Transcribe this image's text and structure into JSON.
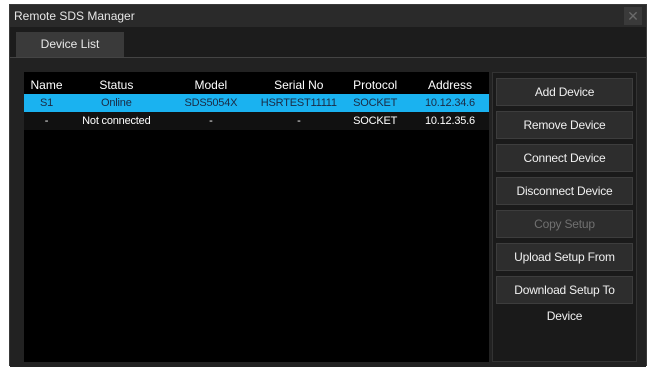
{
  "window": {
    "title": "Remote SDS Manager",
    "close_glyph": "✕"
  },
  "tabs": [
    {
      "label": "Device List"
    }
  ],
  "table": {
    "columns": [
      "Name",
      "Status",
      "Model",
      "Serial No",
      "Protocol",
      "Address"
    ],
    "rows": [
      {
        "name": "S1",
        "status": "Online",
        "model": "SDS5054X",
        "serial": "HSRTEST11111",
        "protocol": "SOCKET",
        "address": "10.12.34.6",
        "selected": true
      },
      {
        "name": "-",
        "status": "Not connected",
        "model": "-",
        "serial": "-",
        "protocol": "SOCKET",
        "address": "10.12.35.6",
        "selected": false
      }
    ]
  },
  "buttons": {
    "add": "Add Device",
    "remove": "Remove Device",
    "connect": "Connect Device",
    "disconnect": "Disconnect Device",
    "copy": "Copy Setup",
    "upload": "Upload Setup From Device",
    "download": "Download Setup To Device"
  },
  "colors": {
    "selection": "#1ab2f0",
    "background": "#000000",
    "panel": "#222222"
  }
}
